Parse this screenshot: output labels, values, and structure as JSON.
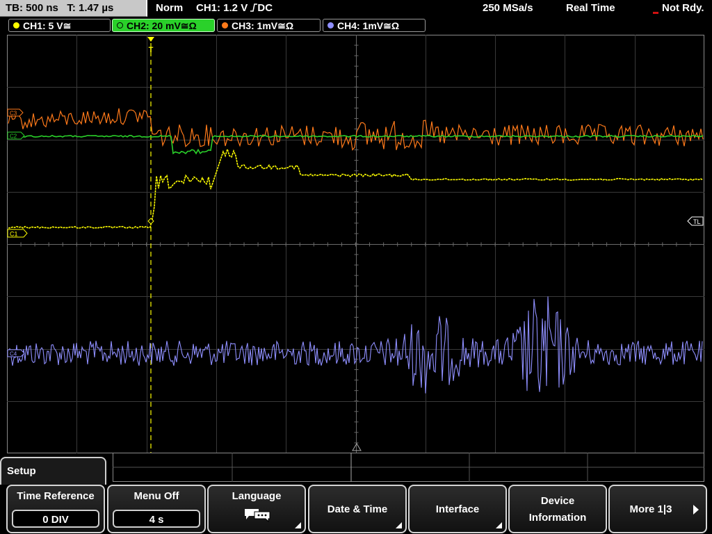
{
  "status": {
    "timebase": "TB: 500 ns",
    "trigger_time": "T: 1.47 µs",
    "trigger_mode": "Norm",
    "trigger_source": "CH1: 1.2 V",
    "trigger_coupling": "DC",
    "sample_rate": "250 MSa/s",
    "acq_mode": "Real Time",
    "acq_state": "Not Rdy."
  },
  "channels": [
    {
      "label": "CH1: 5 V≅",
      "color": "#ffff00",
      "active": false
    },
    {
      "label": "CH2: 20 mV≅Ω",
      "color": "#2ad12a",
      "active": true
    },
    {
      "label": "CH3: 1mV≅Ω",
      "color": "#ff7a1a",
      "active": false
    },
    {
      "label": "CH4: 1mV≅Ω",
      "color": "#8f8fff",
      "active": false
    }
  ],
  "markers": {
    "ch1": "C1",
    "ch2": "C2",
    "ch3": "C3",
    "ch4": "C4",
    "trigger_level": "TL",
    "trigger_position": "T"
  },
  "menu": {
    "title": "Setup",
    "time_reference": {
      "label": "Time Reference",
      "value": "0 DIV"
    },
    "menu_off": {
      "label": "Menu Off",
      "value": "4 s"
    },
    "language": {
      "label": "Language",
      "icon": "speech-bubbles-icon"
    },
    "date_time": {
      "label": "Date & Time"
    },
    "interface": {
      "label": "Interface"
    },
    "device_info": {
      "label_line1": "Device",
      "label_line2": "Information"
    },
    "more": {
      "label": "More 1|3"
    }
  }
}
